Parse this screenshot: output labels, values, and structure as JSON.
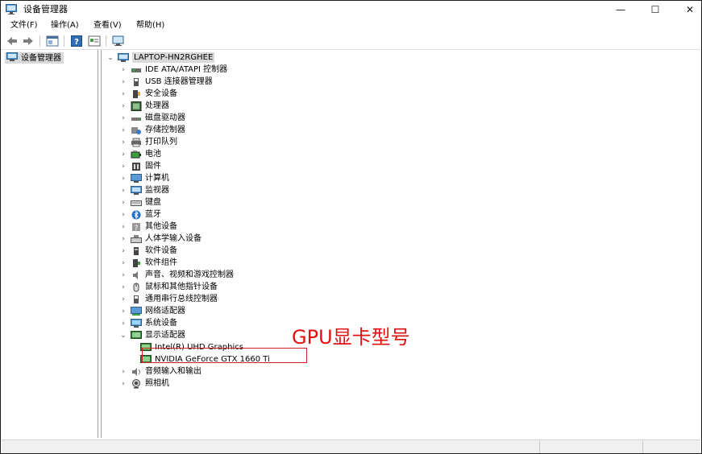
{
  "window": {
    "title": "设备管理器",
    "minimize_symbol": "—",
    "maximize_symbol": "☐",
    "close_symbol": "✕"
  },
  "menu": {
    "items": [
      {
        "label": "文件(F)"
      },
      {
        "label": "操作(A)"
      },
      {
        "label": "查看(V)"
      },
      {
        "label": "帮助(H)"
      }
    ]
  },
  "toolbar": {
    "icons": [
      "back-arrow-icon",
      "forward-arrow-icon",
      "device-view-icon",
      "help-icon",
      "properties-icon",
      "monitor-scan-icon"
    ]
  },
  "left_pane": {
    "item_label": "设备管理器"
  },
  "tree": {
    "root": "LAPTOP-HN2RGHEE",
    "categories": [
      {
        "label": "IDE ATA/ATAPI 控制器",
        "icon": "ide-controller-icon"
      },
      {
        "label": "USB 连接器管理器",
        "icon": "usb-icon"
      },
      {
        "label": "安全设备",
        "icon": "security-device-icon"
      },
      {
        "label": "处理器",
        "icon": "processor-icon"
      },
      {
        "label": "磁盘驱动器",
        "icon": "disk-drive-icon"
      },
      {
        "label": "存储控制器",
        "icon": "storage-controller-icon"
      },
      {
        "label": "打印队列",
        "icon": "printer-icon"
      },
      {
        "label": "电池",
        "icon": "battery-icon"
      },
      {
        "label": "固件",
        "icon": "firmware-icon"
      },
      {
        "label": "计算机",
        "icon": "computer-icon"
      },
      {
        "label": "监视器",
        "icon": "monitor-icon"
      },
      {
        "label": "键盘",
        "icon": "keyboard-icon"
      },
      {
        "label": "蓝牙",
        "icon": "bluetooth-icon"
      },
      {
        "label": "其他设备",
        "icon": "unknown-device-icon"
      },
      {
        "label": "人体学输入设备",
        "icon": "hid-icon"
      },
      {
        "label": "软件设备",
        "icon": "software-device-icon"
      },
      {
        "label": "软件组件",
        "icon": "software-component-icon"
      },
      {
        "label": "声音、视频和游戏控制器",
        "icon": "sound-icon"
      },
      {
        "label": "鼠标和其他指针设备",
        "icon": "mouse-icon"
      },
      {
        "label": "通用串行总线控制器",
        "icon": "usb-controller-icon"
      },
      {
        "label": "网络适配器",
        "icon": "network-adapter-icon"
      },
      {
        "label": "系统设备",
        "icon": "system-device-icon"
      },
      {
        "label": "显示适配器",
        "icon": "display-adapter-icon",
        "expanded": true
      },
      {
        "label": "音频输入和输出",
        "icon": "audio-io-icon"
      },
      {
        "label": "照相机",
        "icon": "camera-icon"
      }
    ],
    "display_children": [
      {
        "label": "Intel(R) UHD Graphics"
      },
      {
        "label": "NVIDIA GeForce GTX 1660 Ti"
      }
    ]
  },
  "annotation": {
    "text": "GPU显卡型号",
    "color": "#e01010"
  },
  "colors": {
    "selection_gray": "#d9d9d9",
    "annotation_red": "#d42020"
  }
}
